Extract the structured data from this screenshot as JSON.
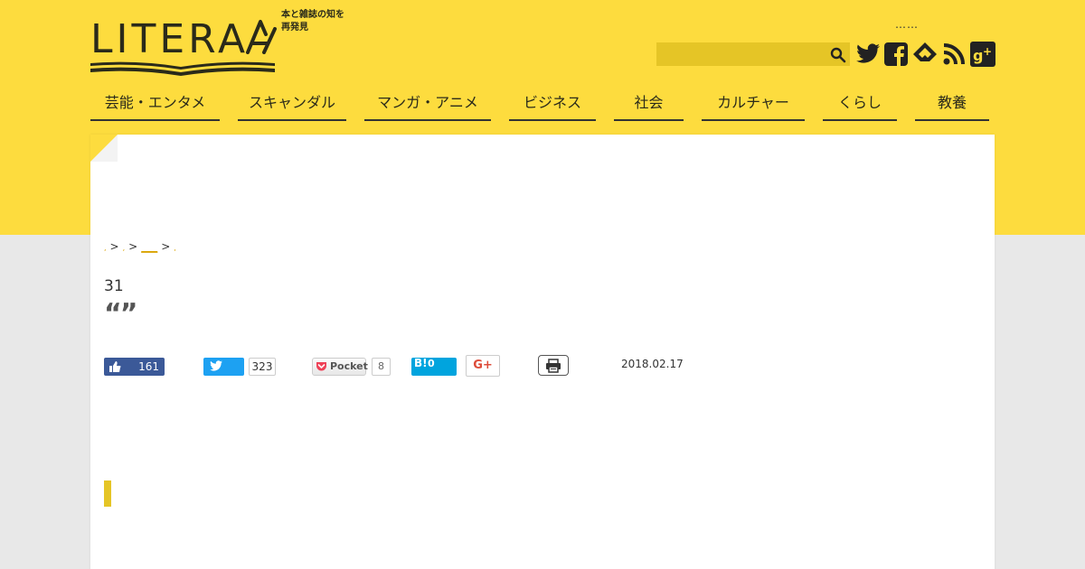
{
  "header": {
    "logo_text": "LITERA",
    "tagline": "本と雑誌の知を再発見",
    "dots": "……",
    "search": {
      "value": "",
      "placeholder": ""
    },
    "social_icons": [
      "twitter-icon",
      "facebook-icon",
      "feedly-icon",
      "rss-icon",
      "google-plus-icon"
    ]
  },
  "nav": {
    "items": [
      "芸能・エンタメ",
      "スキャンダル",
      "マンガ・アニメ",
      "ビジネス",
      "社会",
      "カルチャー",
      "くらし",
      "教養"
    ]
  },
  "breadcrumb": {
    "items": [
      ",",
      ",",
      "___",
      ","
    ],
    "separator": ">"
  },
  "article": {
    "title_number": "31",
    "title_quotes": "“”",
    "date": "2018.02.17"
  },
  "share": {
    "facebook_count": "161",
    "twitter_count": "323",
    "pocket_label": "Pocket",
    "pocket_count": "8",
    "hatena_label": "B!",
    "hatena_count": "0",
    "gplus_label": "G+"
  },
  "colors": {
    "header_yellow": "#fddc3e",
    "search_bg": "#e5c526",
    "page_bg": "#e8e8e8",
    "accent_link": "#d9a300",
    "facebook": "#3b5998",
    "twitter": "#1da1f2",
    "hatena": "#00a4de",
    "gplus": "#dd4b39"
  }
}
